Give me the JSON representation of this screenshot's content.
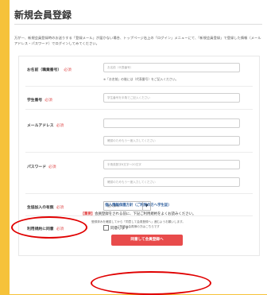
{
  "page": {
    "title": "新規会員登録",
    "intro": "万が一、新規会員登録時のお送りする「登録メール」が届かない場合、トップページ右上の「ログイン」メニューにて、「新規会員登録」で登録した情報（メールアドレス・パスワード）でログインしてみてください。"
  },
  "form": {
    "required_mark": "必須",
    "name": {
      "label": "お名前（職業番号）",
      "placeholder": "お名前（代表番号）",
      "note": "※「お名前」の後には（代表番号）をご記入ください。"
    },
    "student_id": {
      "label": "学生番号",
      "placeholder": "学生番号を半角でご記入ください"
    },
    "email": {
      "label": "メールアドレス",
      "placeholder": "",
      "confirm_placeholder": "確認のためもう一度入力してください"
    },
    "password": {
      "label": "パスワード",
      "placeholder": "半角英数字6文字〜20文字",
      "confirm_placeholder": "確認のためもう一度入力してください"
    },
    "membership": {
      "label": "生協加入の有無",
      "selected": "加入済み"
    },
    "terms": {
      "label": "利用規約に同意",
      "checkbox_label": "同意します"
    },
    "privacy_link": "個人情報保護方針（ご利用の方へ学生証）",
    "notice_prefix": "【重要】",
    "notice_text": "会員登録をされる前に、下記ご利用規約をよくお読みください。",
    "small_note_1": "登録済みを確認してから「同意して会員登録へ」進むようお願いします。",
    "small_note_2": "ご登録の会員様の方はこちらです",
    "submit_label": "同意して会員登録へ"
  },
  "colors": {
    "outer_background": "#f6c23a",
    "submit_button": "#e84b4b",
    "highlight_ellipse": "#e00000",
    "required_mark": "#e05050"
  }
}
